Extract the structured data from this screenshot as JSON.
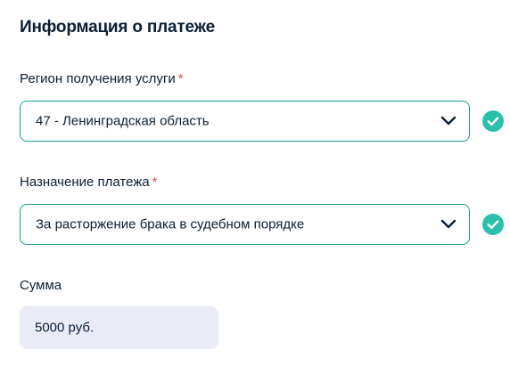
{
  "section": {
    "title": "Информация о платеже"
  },
  "fields": {
    "region": {
      "label": "Регион получения услуги",
      "required_mark": "*",
      "value": "47 - Ленинградская область"
    },
    "purpose": {
      "label": "Назначение платежа",
      "required_mark": "*",
      "value": "За расторжение брака в судебном порядке"
    },
    "amount": {
      "label": "Сумма",
      "value": "5000 руб."
    }
  },
  "icons": {
    "dropdown": "chevron-down-icon",
    "valid": "check-circle-icon"
  },
  "colors": {
    "text": "#0b1f33",
    "accent": "#1e9a93",
    "valid": "#2bbfae",
    "required": "#e04a4a",
    "readonly_bg": "#e9ebf7"
  }
}
